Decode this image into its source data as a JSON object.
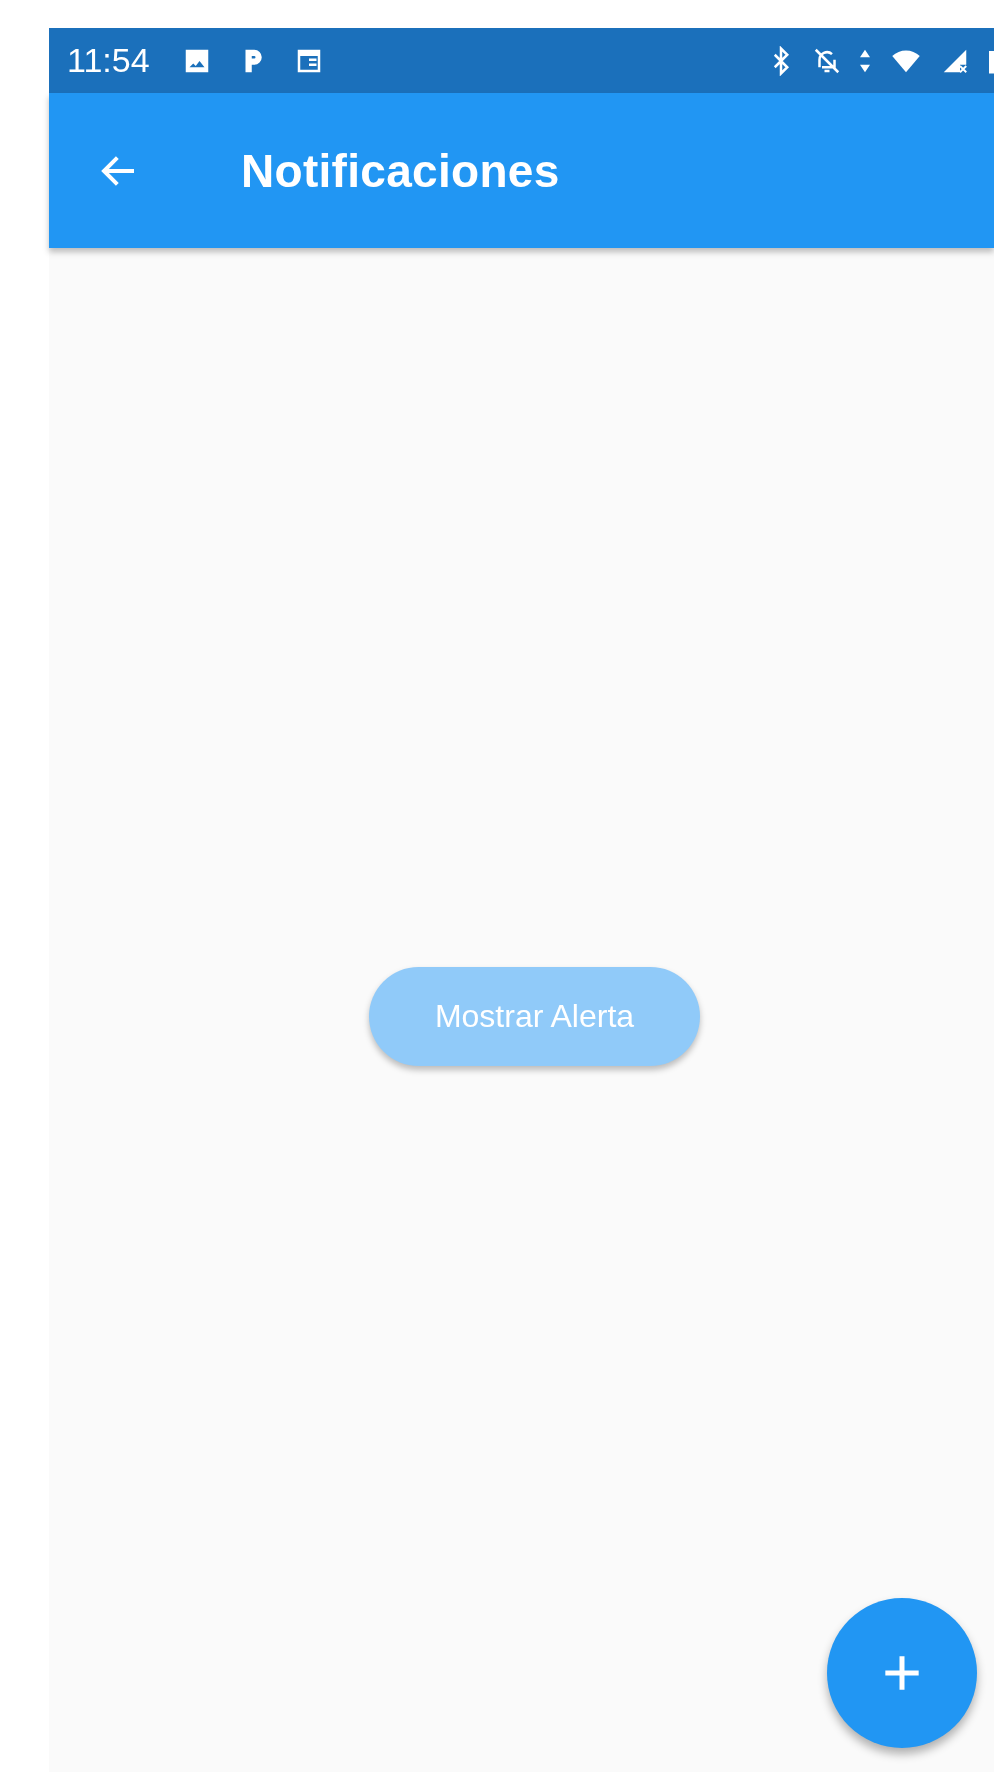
{
  "status_bar": {
    "time": "11:54"
  },
  "app_bar": {
    "title": "Notificaciones"
  },
  "content": {
    "button": {
      "label": "Mostrar Alerta"
    }
  }
}
